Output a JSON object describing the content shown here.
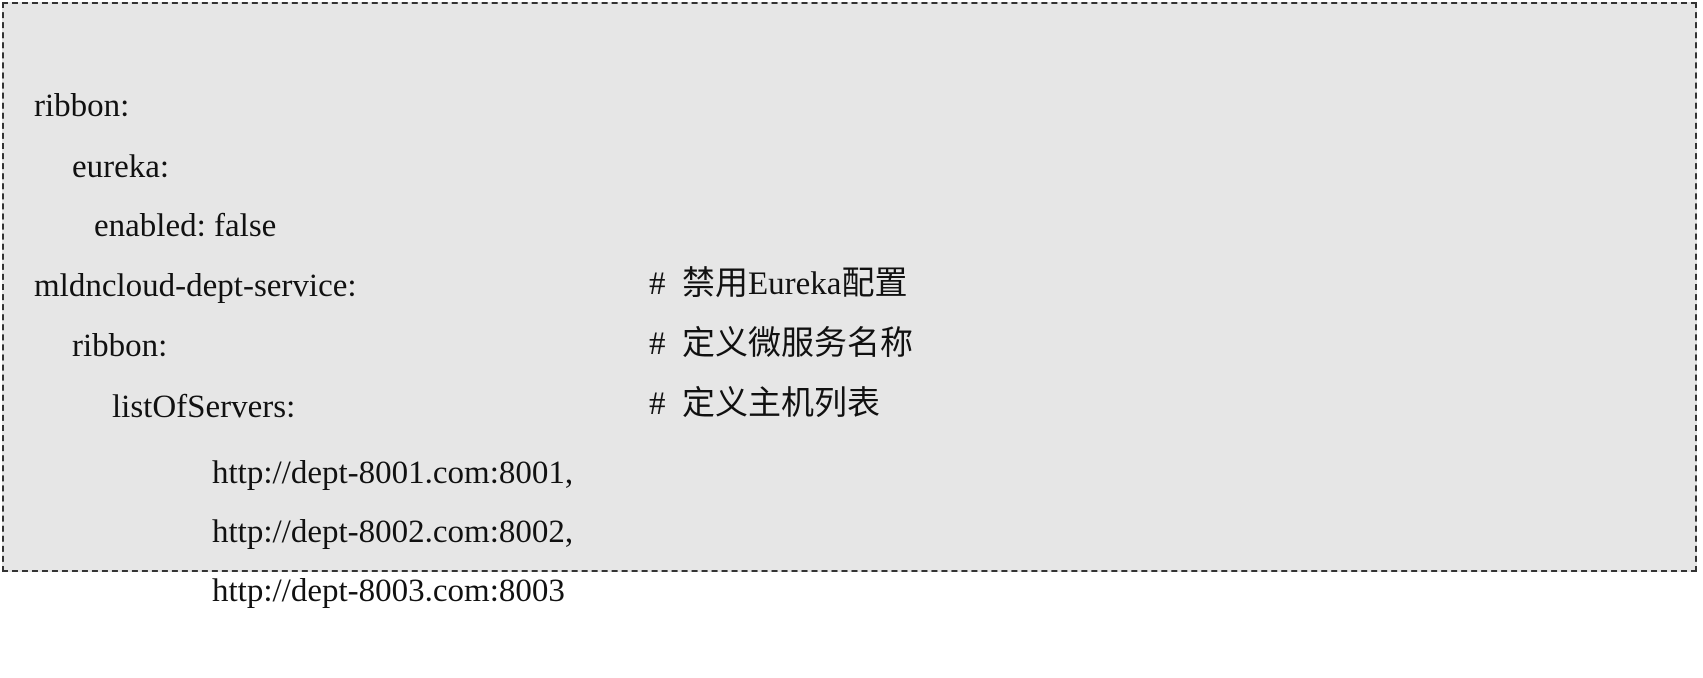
{
  "code_lines": [
    {
      "code": "ribbon:",
      "comment": ""
    },
    {
      "code": "eureka:",
      "comment": ""
    },
    {
      "code": "enabled: false",
      "comment": "#  禁用Eureka配置"
    },
    {
      "code": "mldncloud-dept-service:",
      "comment": "#  定义微服务名称"
    },
    {
      "code": "ribbon:",
      "comment": "#  定义主机列表"
    },
    {
      "code": "listOfServers:",
      "comment": ""
    },
    {
      "code": "http://dept-8001.com:8001,",
      "comment": ""
    },
    {
      "code": "http://dept-8002.com:8002,",
      "comment": ""
    },
    {
      "code": "http://dept-8003.com:8003",
      "comment": ""
    }
  ],
  "colors": {
    "background": "#e6e6e6",
    "border": "#333333",
    "text": "#111111"
  }
}
